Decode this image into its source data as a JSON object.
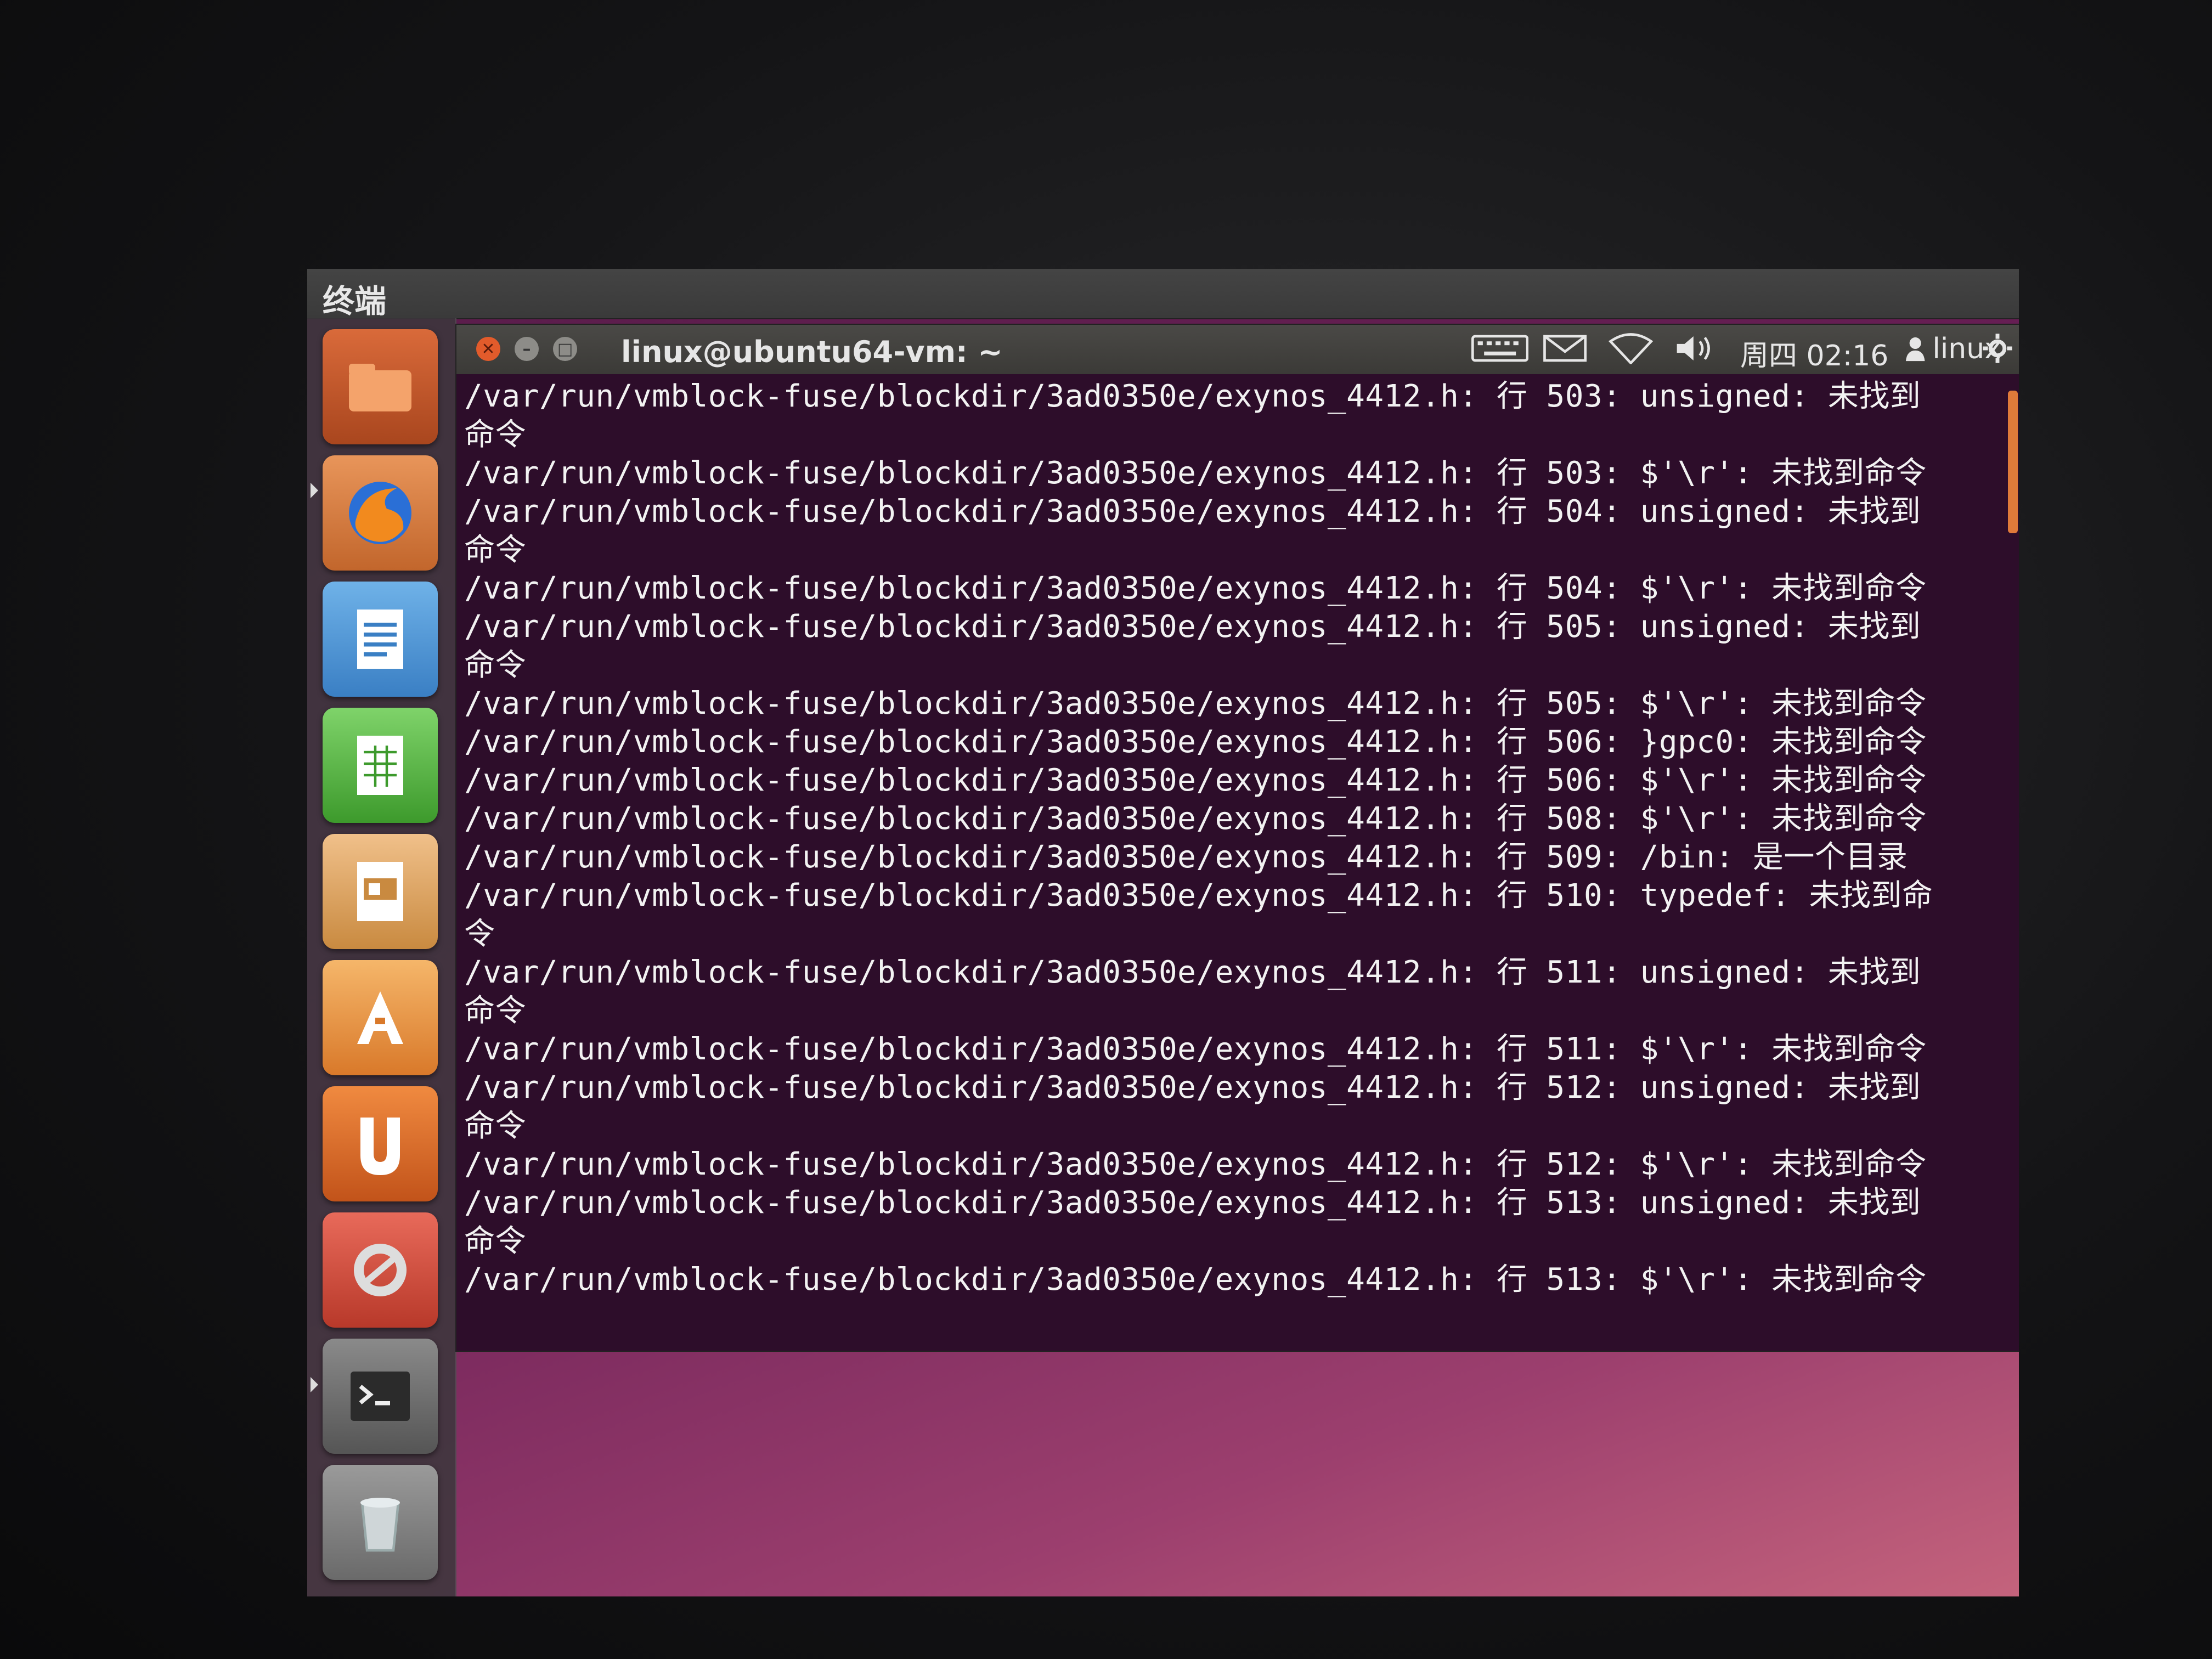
{
  "top_panel": {
    "app_name": "终端"
  },
  "window": {
    "title": "linux@ubuntu64-vm: ~"
  },
  "indicators": {
    "clock": "周四 02:16",
    "user": "linux"
  },
  "launcher": {
    "items": [
      {
        "name": "home-folder",
        "icon": "folder-icon"
      },
      {
        "name": "firefox",
        "icon": "firefox-icon"
      },
      {
        "name": "libreoffice-writer",
        "icon": "writer-icon"
      },
      {
        "name": "libreoffice-calc",
        "icon": "calc-icon"
      },
      {
        "name": "libreoffice-impress",
        "icon": "impress-icon"
      },
      {
        "name": "ubuntu-software-center",
        "icon": "software-center-icon"
      },
      {
        "name": "ubuntu-one",
        "icon": "ubuntu-one-icon"
      },
      {
        "name": "system-settings",
        "icon": "settings-icon"
      },
      {
        "name": "terminal",
        "icon": "terminal-icon"
      },
      {
        "name": "trash",
        "icon": "trash-icon"
      }
    ]
  },
  "terminal": {
    "lines": [
      "/var/run/vmblock-fuse/blockdir/3ad0350e/exynos_4412.h: 行 503: unsigned: 未找到",
      "命令",
      "/var/run/vmblock-fuse/blockdir/3ad0350e/exynos_4412.h: 行 503: $'\\r': 未找到命令",
      "/var/run/vmblock-fuse/blockdir/3ad0350e/exynos_4412.h: 行 504: unsigned: 未找到",
      "命令",
      "/var/run/vmblock-fuse/blockdir/3ad0350e/exynos_4412.h: 行 504: $'\\r': 未找到命令",
      "/var/run/vmblock-fuse/blockdir/3ad0350e/exynos_4412.h: 行 505: unsigned: 未找到",
      "命令",
      "/var/run/vmblock-fuse/blockdir/3ad0350e/exynos_4412.h: 行 505: $'\\r': 未找到命令",
      "/var/run/vmblock-fuse/blockdir/3ad0350e/exynos_4412.h: 行 506: }gpc0: 未找到命令",
      "/var/run/vmblock-fuse/blockdir/3ad0350e/exynos_4412.h: 行 506: $'\\r': 未找到命令",
      "/var/run/vmblock-fuse/blockdir/3ad0350e/exynos_4412.h: 行 508: $'\\r': 未找到命令",
      "/var/run/vmblock-fuse/blockdir/3ad0350e/exynos_4412.h: 行 509: /bin: 是一个目录",
      "/var/run/vmblock-fuse/blockdir/3ad0350e/exynos_4412.h: 行 510: typedef: 未找到命",
      "令",
      "/var/run/vmblock-fuse/blockdir/3ad0350e/exynos_4412.h: 行 511: unsigned: 未找到",
      "命令",
      "/var/run/vmblock-fuse/blockdir/3ad0350e/exynos_4412.h: 行 511: $'\\r': 未找到命令",
      "/var/run/vmblock-fuse/blockdir/3ad0350e/exynos_4412.h: 行 512: unsigned: 未找到",
      "命令",
      "/var/run/vmblock-fuse/blockdir/3ad0350e/exynos_4412.h: 行 512: $'\\r': 未找到命令",
      "/var/run/vmblock-fuse/blockdir/3ad0350e/exynos_4412.h: 行 513: unsigned: 未找到",
      "命令",
      "/var/run/vmblock-fuse/blockdir/3ad0350e/exynos_4412.h: 行 513: $'\\r': 未找到命令"
    ]
  },
  "colors": {
    "terminal_bg": "#2d0d2a",
    "close_button": "#e25b2b",
    "scrollbar": "#e07a3a"
  }
}
